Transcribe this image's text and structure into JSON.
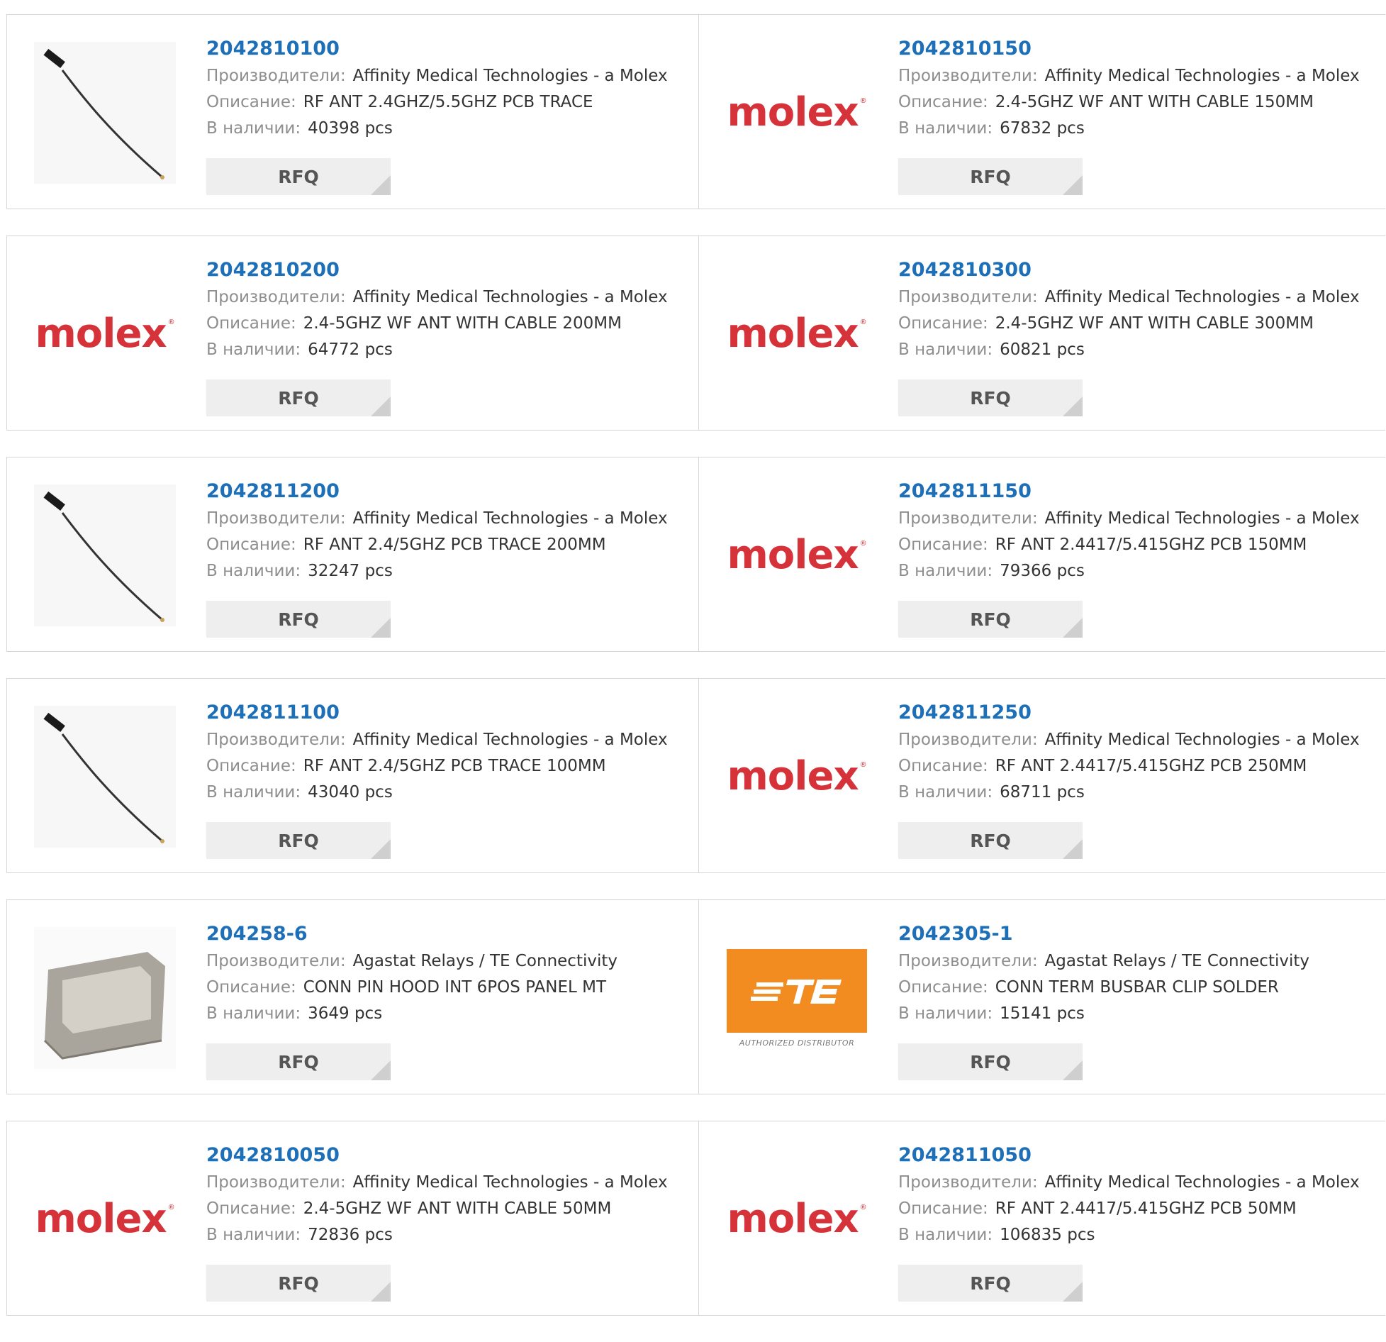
{
  "labels": {
    "manufacturer": "Производители:",
    "description": "Описание:",
    "stock": "В наличии:",
    "rfq": "RFQ"
  },
  "brand": {
    "molex_text": "molex",
    "molex_reg": "®",
    "te_caption": "AUTHORIZED DISTRIBUTOR",
    "molex_color": "#d6323a",
    "te_color": "#f28c20",
    "link_color": "#1d6fb8"
  },
  "products": [
    {
      "part": "2042810100",
      "manufacturer": "Affinity Medical Technologies - a Molex",
      "description": "RF ANT 2.4GHZ/5.5GHZ PCB TRACE",
      "stock": "40398 pcs",
      "image": "antenna-cable-photo"
    },
    {
      "part": "2042810150",
      "manufacturer": "Affinity Medical Technologies - a Molex",
      "description": "2.4-5GHZ WF ANT WITH CABLE 150MM",
      "stock": "67832 pcs",
      "image": "molex-logo"
    },
    {
      "part": "2042810200",
      "manufacturer": "Affinity Medical Technologies - a Molex",
      "description": "2.4-5GHZ WF ANT WITH CABLE 200MM",
      "stock": "64772 pcs",
      "image": "molex-logo"
    },
    {
      "part": "2042810300",
      "manufacturer": "Affinity Medical Technologies - a Molex",
      "description": "2.4-5GHZ WF ANT WITH CABLE 300MM",
      "stock": "60821 pcs",
      "image": "molex-logo"
    },
    {
      "part": "2042811200",
      "manufacturer": "Affinity Medical Technologies - a Molex",
      "description": "RF ANT 2.4/5GHZ PCB TRACE 200MM",
      "stock": "32247 pcs",
      "image": "antenna-cable-photo"
    },
    {
      "part": "2042811150",
      "manufacturer": "Affinity Medical Technologies - a Molex",
      "description": "RF ANT 2.4417/5.415GHZ PCB 150MM",
      "stock": "79366 pcs",
      "image": "molex-logo"
    },
    {
      "part": "2042811100",
      "manufacturer": "Affinity Medical Technologies - a Molex",
      "description": "RF ANT 2.4/5GHZ PCB TRACE 100MM",
      "stock": "43040 pcs",
      "image": "antenna-cable-photo"
    },
    {
      "part": "2042811250",
      "manufacturer": "Affinity Medical Technologies - a Molex",
      "description": "RF ANT 2.4417/5.415GHZ PCB 250MM",
      "stock": "68711 pcs",
      "image": "molex-logo"
    },
    {
      "part": "204258-6",
      "manufacturer": "Agastat Relays / TE Connectivity",
      "description": "CONN PIN HOOD INT 6POS PANEL MT",
      "stock": "3649 pcs",
      "image": "metal-hood-photo"
    },
    {
      "part": "2042305-1",
      "manufacturer": "Agastat Relays / TE Connectivity",
      "description": "CONN TERM BUSBAR CLIP SOLDER",
      "stock": "15141 pcs",
      "image": "te-logo"
    },
    {
      "part": "2042810050",
      "manufacturer": "Affinity Medical Technologies - a Molex",
      "description": "2.4-5GHZ WF ANT WITH CABLE 50MM",
      "stock": "72836 pcs",
      "image": "molex-logo"
    },
    {
      "part": "2042811050",
      "manufacturer": "Affinity Medical Technologies - a Molex",
      "description": "RF ANT 2.4417/5.415GHZ PCB 50MM",
      "stock": "106835 pcs",
      "image": "molex-logo"
    }
  ]
}
